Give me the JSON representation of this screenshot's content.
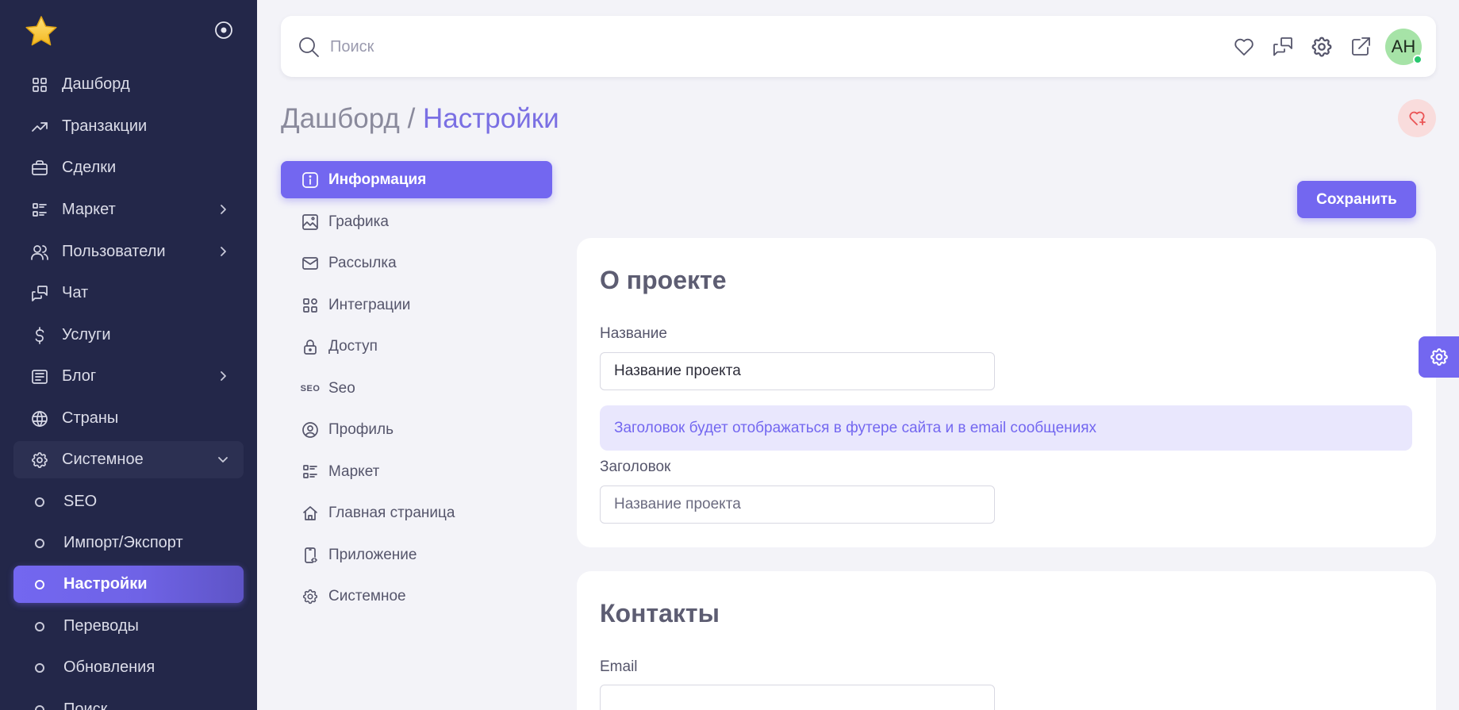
{
  "sidebar": {
    "items": [
      {
        "label": "Дашборд",
        "icon": "dashboard-icon"
      },
      {
        "label": "Транзакции",
        "icon": "trend-icon"
      },
      {
        "label": "Сделки",
        "icon": "briefcase-icon"
      },
      {
        "label": "Маркет",
        "icon": "list-details-icon"
      },
      {
        "label": "Пользователи",
        "icon": "users-icon"
      },
      {
        "label": "Чат",
        "icon": "messages-icon"
      },
      {
        "label": "Услуги",
        "icon": "dollar-icon"
      },
      {
        "label": "Блог",
        "icon": "article-icon"
      },
      {
        "label": "Страны",
        "icon": "globe-icon"
      },
      {
        "label": "Системное",
        "icon": "settings-icon"
      }
    ],
    "subitems": [
      {
        "label": "SEO"
      },
      {
        "label": "Импорт/Экспорт"
      },
      {
        "label": "Настройки"
      },
      {
        "label": "Переводы"
      },
      {
        "label": "Обновления"
      },
      {
        "label": "Поиск"
      }
    ]
  },
  "topbar": {
    "search_placeholder": "Поиск",
    "avatar_initials": "AH"
  },
  "breadcrumb": {
    "parent": "Дашборд",
    "separator": " / ",
    "current": "Настройки"
  },
  "settings_nav": [
    {
      "label": "Информация",
      "icon": "info-icon"
    },
    {
      "label": "Графика",
      "icon": "photo-icon"
    },
    {
      "label": "Рассылка",
      "icon": "mail-icon"
    },
    {
      "label": "Интеграции",
      "icon": "apps-icon"
    },
    {
      "label": "Доступ",
      "icon": "lock-icon"
    },
    {
      "label": "Seo",
      "icon": "seo-icon",
      "icon_text": "SEO"
    },
    {
      "label": "Профиль",
      "icon": "user-circle-icon"
    },
    {
      "label": "Маркет",
      "icon": "list-details-icon"
    },
    {
      "label": "Главная страница",
      "icon": "home-icon"
    },
    {
      "label": "Приложение",
      "icon": "device-mobile-icon"
    },
    {
      "label": "Системное",
      "icon": "settings-icon"
    }
  ],
  "actions": {
    "save_label": "Сохранить"
  },
  "about_card": {
    "title": "О проекте",
    "name_label": "Название",
    "name_value": "Название проекта",
    "info_text": "Заголовок будет отображаться в футере сайта и в email сообщениях",
    "heading_label": "Заголовок",
    "heading_placeholder": "Название проекта"
  },
  "contacts_card": {
    "title": "Контакты",
    "email_label": "Email",
    "email_value": ""
  },
  "colors": {
    "accent": "#7367f0",
    "sidebar_bg": "#232749",
    "page_bg": "#f3f3f8",
    "danger": "#ea5455",
    "online": "#28c76f"
  }
}
